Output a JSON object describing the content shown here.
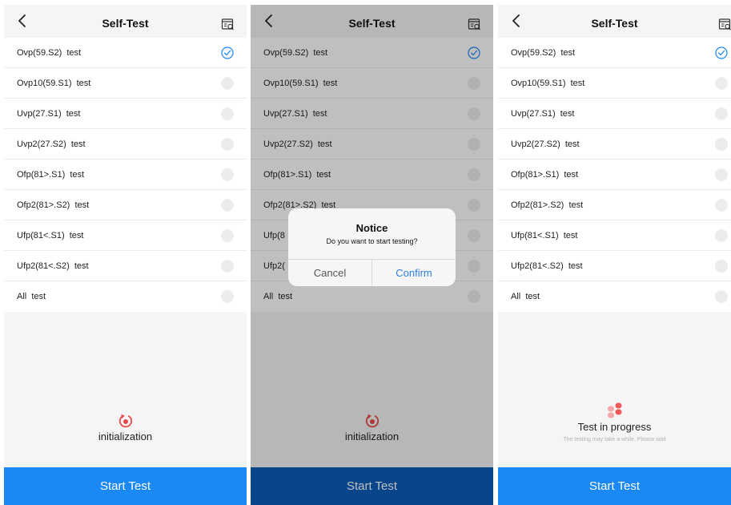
{
  "colors": {
    "primary": "#1a88f5",
    "overlay_button": "#0b5cb8",
    "check": "#1a88f5",
    "init_icon": "#e84a4a",
    "progress_icon_light": "#f6a7a7",
    "progress_icon_dark": "#ee5a5a"
  },
  "screens": [
    {
      "header": {
        "title": "Self-Test",
        "back_icon": "chevron-left-icon",
        "report_icon": "report-search-icon"
      },
      "tests": [
        {
          "label": "Ovp(59.S2)  test",
          "checked": true
        },
        {
          "label": "Ovp10(59.S1)  test",
          "checked": false
        },
        {
          "label": "Uvp(27.S1)  test",
          "checked": false
        },
        {
          "label": "Uvp2(27.S2)  test",
          "checked": false
        },
        {
          "label": "Ofp(81>.S1)  test",
          "checked": false
        },
        {
          "label": "Ofp2(81>.S2)  test",
          "checked": false
        },
        {
          "label": "Ufp(81<.S1)  test",
          "checked": false
        },
        {
          "label": "Ufp2(81<.S2)  test",
          "checked": false
        },
        {
          "label": "All  test",
          "checked": false
        }
      ],
      "status": {
        "icon": "reset-icon",
        "label": "initialization"
      },
      "button": "Start Test"
    },
    {
      "header": {
        "title": "Self-Test",
        "back_icon": "chevron-left-icon",
        "report_icon": "report-search-icon"
      },
      "tests": [
        {
          "label": "Ovp(59.S2)  test",
          "checked": true
        },
        {
          "label": "Ovp10(59.S1)  test",
          "checked": false
        },
        {
          "label": "Uvp(27.S1)  test",
          "checked": false
        },
        {
          "label": "Uvp2(27.S2)  test",
          "checked": false
        },
        {
          "label": "Ofp(81>.S1)  test",
          "checked": false
        },
        {
          "label": "Ofp2(81>.S2)  test",
          "checked": false
        },
        {
          "label": "Ufp(8",
          "checked": false
        },
        {
          "label": "Ufp2(",
          "checked": false
        },
        {
          "label": "All  test",
          "checked": false
        }
      ],
      "status": {
        "icon": "reset-icon",
        "label": "initialization"
      },
      "button": "Start Test",
      "dialog": {
        "title": "Notice",
        "message": "Do you want to start testing?",
        "cancel": "Cancel",
        "confirm": "Confirm"
      }
    },
    {
      "header": {
        "title": "Self-Test",
        "back_icon": "chevron-left-icon",
        "report_icon": "report-search-icon"
      },
      "tests": [
        {
          "label": "Ovp(59.S2)  test",
          "checked": true
        },
        {
          "label": "Ovp10(59.S1)  test",
          "checked": false
        },
        {
          "label": "Uvp(27.S1)  test",
          "checked": false
        },
        {
          "label": "Uvp2(27.S2)  test",
          "checked": false
        },
        {
          "label": "Ofp(81>.S1)  test",
          "checked": false
        },
        {
          "label": "Ofp2(81>.S2)  test",
          "checked": false
        },
        {
          "label": "Ufp(81<.S1)  test",
          "checked": false
        },
        {
          "label": "Ufp2(81<.S2)  test",
          "checked": false
        },
        {
          "label": "All  test",
          "checked": false
        }
      ],
      "status": {
        "icon": "progress-icon",
        "label": "Test in progress",
        "sublabel": "The testing may take a while. Please wait"
      },
      "button": "Start Test"
    }
  ]
}
